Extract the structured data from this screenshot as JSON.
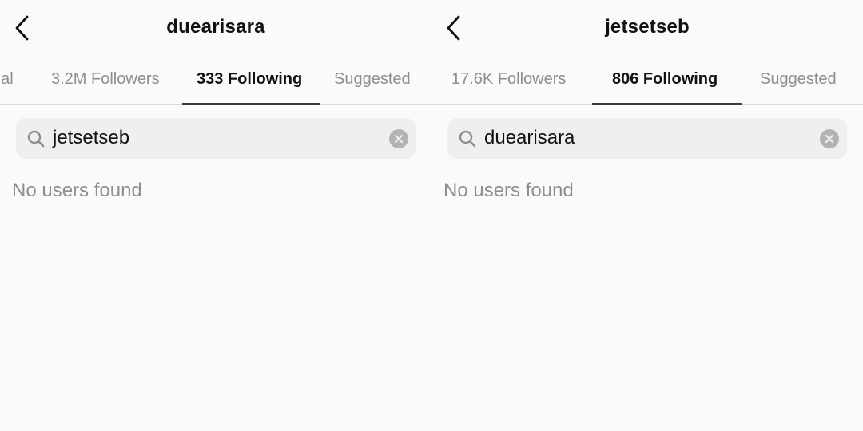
{
  "left_panel": {
    "title": "duearisara",
    "tabs": [
      {
        "label": "ual"
      },
      {
        "label": "3.2M Followers"
      },
      {
        "label": "333 Following",
        "active": true
      },
      {
        "label": "Suggested"
      }
    ],
    "search": {
      "value": "jetsetseb"
    },
    "empty_message": "No users found"
  },
  "right_panel": {
    "title": "jetsetseb",
    "tabs": [
      {
        "label": "17.6K Followers"
      },
      {
        "label": "806 Following",
        "active": true
      },
      {
        "label": "Suggested"
      }
    ],
    "search": {
      "value": "duearisara"
    },
    "empty_message": "No users found"
  },
  "icons": {
    "back": "chevron-left-icon",
    "search": "magnifier-icon",
    "clear": "x-circle-icon"
  },
  "colors": {
    "background": "#fafafa",
    "search_bg": "#efefef",
    "muted_text": "#8e8e8e",
    "primary_text": "#111111",
    "divider": "#dbdbdb",
    "active_underline": "#3c3c3c"
  }
}
